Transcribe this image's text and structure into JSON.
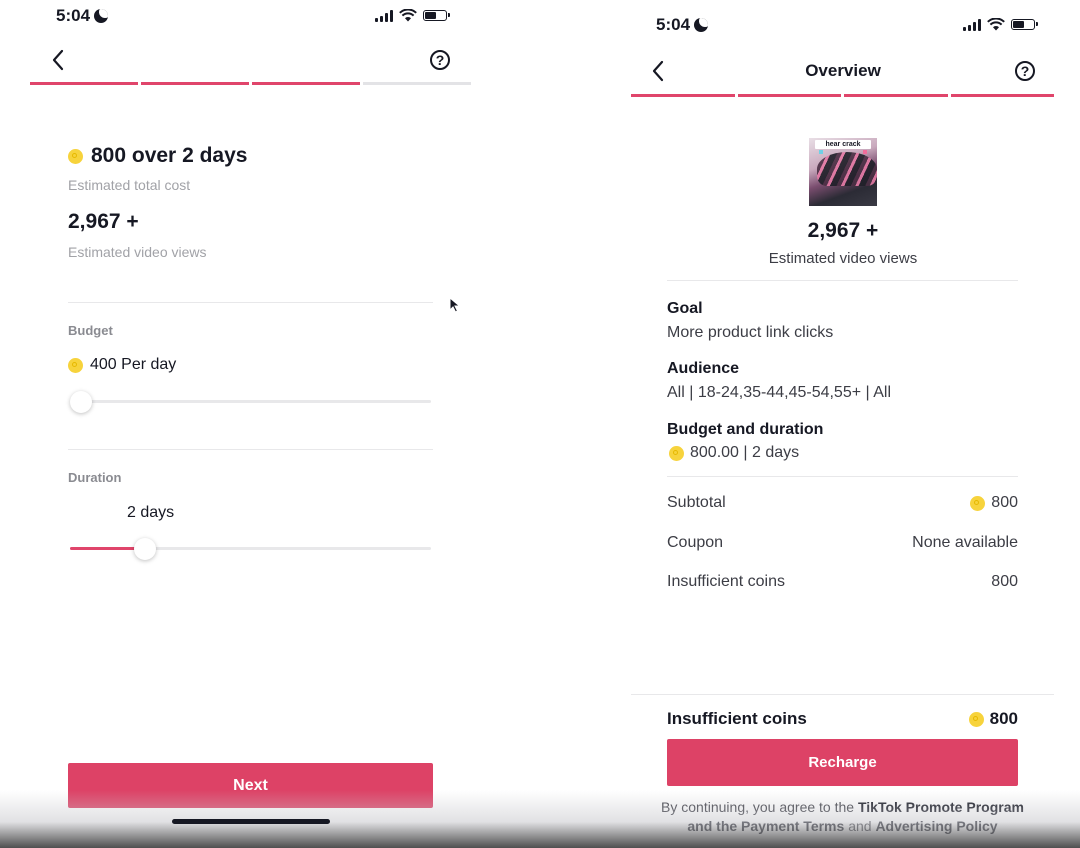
{
  "left": {
    "status_time": "5:04",
    "nav": {
      "back_icon": "chevron-left-icon",
      "help_icon": "question-circle-icon",
      "help_glyph": "?"
    },
    "progress": [
      "filled",
      "filled",
      "filled",
      "empty"
    ],
    "cost_headline": "800 over 2 days",
    "cost_caption": "Estimated total cost",
    "views_value": "2,967 +",
    "views_caption": "Estimated video views",
    "budget": {
      "label": "Budget",
      "value": "400 Per day",
      "slider_fraction": 0.0
    },
    "duration": {
      "label": "Duration",
      "value": "2 days",
      "slider_fraction": 0.19
    },
    "next_button": "Next"
  },
  "right": {
    "status_time": "5:04",
    "nav": {
      "title": "Overview",
      "back_icon": "chevron-left-icon",
      "help_icon": "question-circle-icon",
      "help_glyph": "?"
    },
    "progress": [
      "filled",
      "filled",
      "filled",
      "filled"
    ],
    "thumbnail_caption": "hear crack",
    "views_value": "2,967 +",
    "views_caption": "Estimated video views",
    "goal": {
      "title": "Goal",
      "value": "More product link clicks"
    },
    "audience": {
      "title": "Audience",
      "value": "All | 18-24,35-44,45-54,55+ | All"
    },
    "budget_duration": {
      "title": "Budget and duration",
      "value": "800.00 | 2 days"
    },
    "subtotal": {
      "label": "Subtotal",
      "value": "800"
    },
    "coupon": {
      "label": "Coupon",
      "value": "None available"
    },
    "insufficient_row": {
      "label": "Insufficient coins",
      "value": "800"
    },
    "footer": {
      "label": "Insufficient coins",
      "value": "800",
      "recharge_button": "Recharge",
      "terms_prefix": "By continuing, you agree to the",
      "terms_link1": "TikTok Promote Program and the Payment Terms",
      "terms_and": "and",
      "terms_link2": "Advertising Policy"
    }
  },
  "colors": {
    "accent": "#dd4266",
    "progress_filled": "#e0456b",
    "progress_empty": "#e3e3e6",
    "coin": "#f7d33c",
    "text": "#161823",
    "muted": "#a1a2a7"
  }
}
